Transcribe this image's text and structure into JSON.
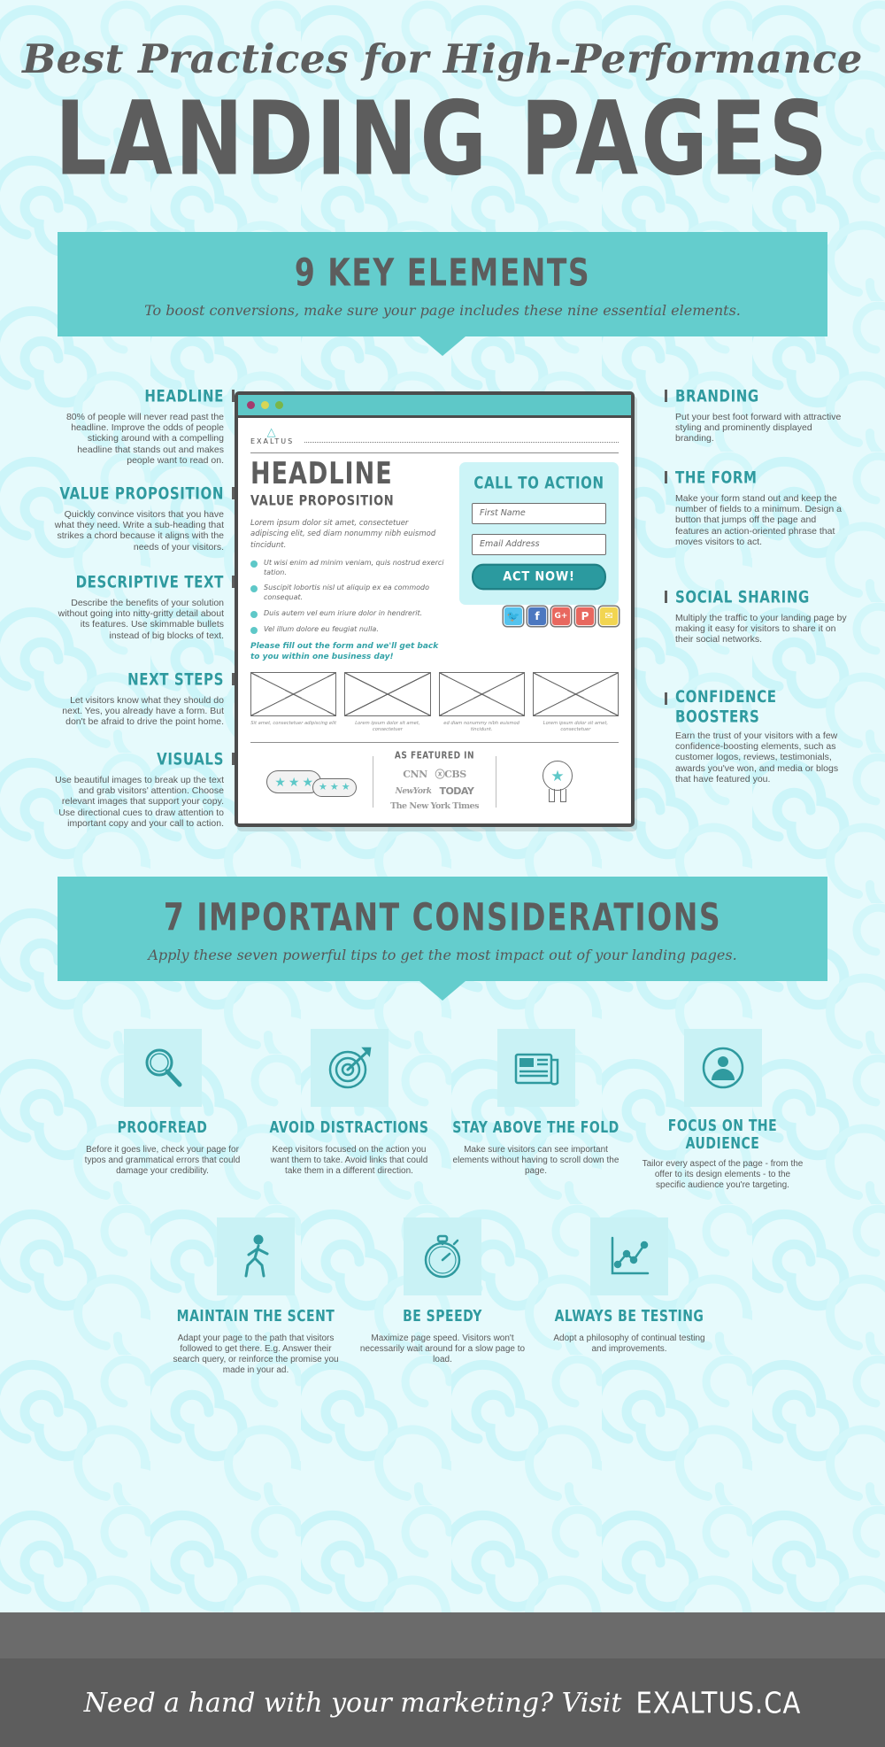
{
  "colors": {
    "teal": "#64cdcd",
    "teal_dark": "#2f9a9f",
    "bg": "#e6fafc",
    "grey_text": "#5d5d5d",
    "light_teal": "#c9f2f5",
    "footer": "#5d5d5d"
  },
  "header": {
    "script_line": "Best Practices for High-Performance",
    "main_line": "LANDING PAGES"
  },
  "section1": {
    "title": "9 KEY ELEMENTS",
    "subtitle": "To boost conversions, make sure your page includes these nine essential elements."
  },
  "annotations_left": [
    {
      "title": "HEADLINE",
      "body": "80% of people will never read past the headline. Improve the odds of people sticking around with a compelling headline that stands out and makes people want to read on."
    },
    {
      "title": "VALUE PROPOSITION",
      "body": "Quickly convince visitors that you have what they need. Write a sub-heading that strikes a chord because it aligns with the needs of your visitors."
    },
    {
      "title": "DESCRIPTIVE TEXT",
      "body": "Describe the benefits of your solution without going into nitty-gritty detail about its features. Use skimmable bullets instead of big blocks of text."
    },
    {
      "title": "NEXT STEPS",
      "body": "Let visitors know what they should do next. Yes, you already have a form. But don't be afraid to drive the point home."
    },
    {
      "title": "VISUALS",
      "body": "Use beautiful images to break up the text and grab visitors' attention. Choose relevant images that support your copy.  Use directional cues to draw attention to important copy and your call to action."
    }
  ],
  "annotations_right": [
    {
      "title": "BRANDING",
      "body": "Put your best foot forward with attractive styling and prominently displayed branding."
    },
    {
      "title": "THE FORM",
      "body": "Make your form stand out and keep the number of fields to a minimum. Design a button that jumps off the page and features an action-oriented phrase that moves visitors to act."
    },
    {
      "title": "SOCIAL SHARING",
      "body": "Multiply the traffic to your landing page by making it easy for visitors to share it on their social networks."
    },
    {
      "title": "CONFIDENCE BOOSTERS",
      "body": "Earn the trust of your visitors with a few confidence-boosting elements, such as customer logos, reviews, testimonials, awards you've won, and media or blogs that have featured you."
    }
  ],
  "mockup": {
    "logo_text": "EXALTUS",
    "headline": "HEADLINE",
    "value_proposition": "VALUE PROPOSITION",
    "lorem": "Lorem ipsum dolor sit amet, consectetuer adipiscing elit, sed diam nonummy nibh euismod tincidunt.",
    "bullets": [
      "Ut wisi enim ad minim veniam, quis nostrud exerci tation.",
      "Suscipit lobortis nisl ut aliquip ex ea commodo consequat.",
      "Duis autem vel eum iriure dolor in hendrerit.",
      "Vel illum dolore eu feugiat nulla."
    ],
    "form_note": "Please fill out the form and we'll get back to you within one business day!",
    "cta": {
      "title": "CALL TO ACTION",
      "first_name_placeholder": "First Name",
      "email_placeholder": "Email Address",
      "button_label": "ACT NOW!"
    },
    "social": [
      {
        "name": "twitter-icon",
        "glyph": "🐦",
        "color": "#55c3ee"
      },
      {
        "name": "facebook-icon",
        "glyph": "f",
        "color": "#4c78c0"
      },
      {
        "name": "google-plus-icon",
        "glyph": "G+",
        "color": "#e8685f"
      },
      {
        "name": "pinterest-icon",
        "glyph": "P",
        "color": "#e8685f"
      },
      {
        "name": "email-icon",
        "glyph": "✉",
        "color": "#f2d551"
      }
    ],
    "thumb_captions": [
      "Sit amet, consectetuer adipiscing elit",
      "Lorem ipsum dolor sit amet, consectetuer",
      "ed diam nonummy nibh euismod tincidunt.",
      "Lorem ipsum dolor sit amet, consectetuer"
    ],
    "featured_label": "AS FEATURED IN",
    "featured_logos_row1": [
      "CNN",
      "ⓧCBS"
    ],
    "featured_logos_row2": [
      "NewYork",
      "TODAY"
    ],
    "featured_logos_row3": [
      "The New York Times"
    ],
    "stars_large": "★★★",
    "stars_small": "★★★",
    "badge_star": "★"
  },
  "section2": {
    "title": "7 IMPORTANT CONSIDERATIONS",
    "subtitle": "Apply these seven powerful tips to get the most impact out of your landing pages."
  },
  "considerations": [
    {
      "icon": "magnifier-icon",
      "title": "PROOFREAD",
      "body": "Before it goes live, check your page for typos and grammatical errors that could damage your credibility."
    },
    {
      "icon": "target-icon",
      "title": "AVOID DISTRACTIONS",
      "body": "Keep visitors focused on the action you want them to take. Avoid links that could take them in a different direction."
    },
    {
      "icon": "newspaper-icon",
      "title": "STAY ABOVE THE FOLD",
      "body": "Make sure visitors can see important elements without having to scroll down the page."
    },
    {
      "icon": "audience-icon",
      "title": "FOCUS ON THE AUDIENCE",
      "body": "Tailor every aspect of the page - from the offer to its design elements - to the specific audience you're targeting."
    },
    {
      "icon": "walking-icon",
      "title": "MAINTAIN THE SCENT",
      "body": "Adapt your page to the path that visitors followed to get there. E.g. Answer their search query, or reinforce the promise you made in your ad."
    },
    {
      "icon": "stopwatch-icon",
      "title": "BE SPEEDY",
      "body": "Maximize page speed. Visitors won't necessarily wait around for a slow page to load."
    },
    {
      "icon": "chart-icon",
      "title": "ALWAYS BE TESTING",
      "body": "Adopt  a philosophy of continual testing and improvements."
    }
  ],
  "footer": {
    "script": "Need a hand with your marketing? Visit",
    "brand": "EXALTUS.CA"
  }
}
